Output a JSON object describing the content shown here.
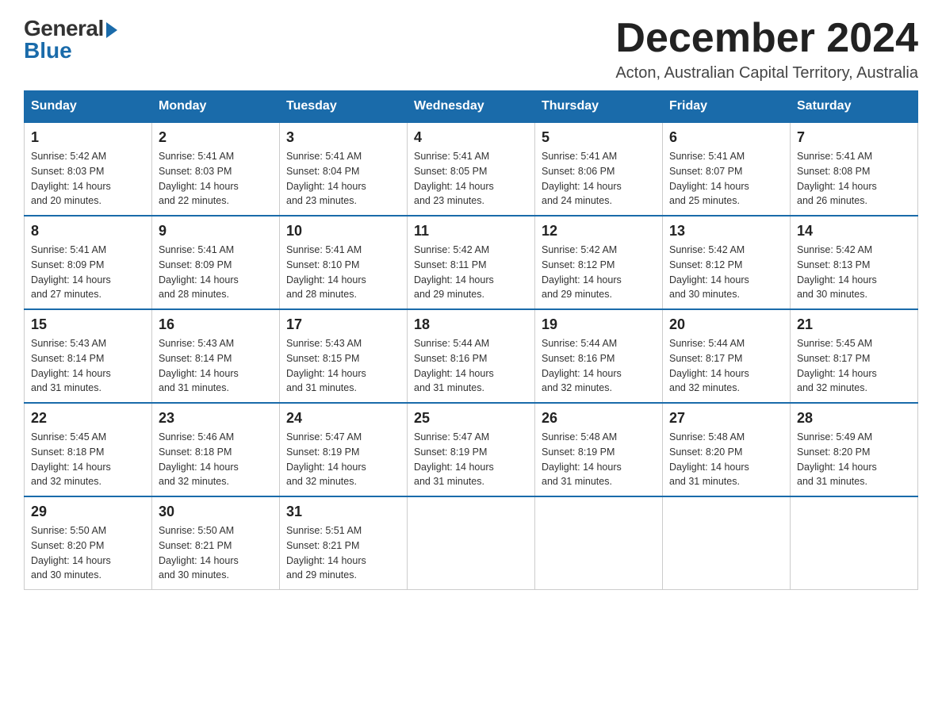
{
  "logo": {
    "general": "General",
    "blue": "Blue"
  },
  "title": {
    "month": "December 2024",
    "location": "Acton, Australian Capital Territory, Australia"
  },
  "weekdays": [
    "Sunday",
    "Monday",
    "Tuesday",
    "Wednesday",
    "Thursday",
    "Friday",
    "Saturday"
  ],
  "weeks": [
    [
      {
        "day": 1,
        "sunrise": "5:42 AM",
        "sunset": "8:03 PM",
        "daylight": "14 hours and 20 minutes."
      },
      {
        "day": 2,
        "sunrise": "5:41 AM",
        "sunset": "8:03 PM",
        "daylight": "14 hours and 22 minutes."
      },
      {
        "day": 3,
        "sunrise": "5:41 AM",
        "sunset": "8:04 PM",
        "daylight": "14 hours and 23 minutes."
      },
      {
        "day": 4,
        "sunrise": "5:41 AM",
        "sunset": "8:05 PM",
        "daylight": "14 hours and 23 minutes."
      },
      {
        "day": 5,
        "sunrise": "5:41 AM",
        "sunset": "8:06 PM",
        "daylight": "14 hours and 24 minutes."
      },
      {
        "day": 6,
        "sunrise": "5:41 AM",
        "sunset": "8:07 PM",
        "daylight": "14 hours and 25 minutes."
      },
      {
        "day": 7,
        "sunrise": "5:41 AM",
        "sunset": "8:08 PM",
        "daylight": "14 hours and 26 minutes."
      }
    ],
    [
      {
        "day": 8,
        "sunrise": "5:41 AM",
        "sunset": "8:09 PM",
        "daylight": "14 hours and 27 minutes."
      },
      {
        "day": 9,
        "sunrise": "5:41 AM",
        "sunset": "8:09 PM",
        "daylight": "14 hours and 28 minutes."
      },
      {
        "day": 10,
        "sunrise": "5:41 AM",
        "sunset": "8:10 PM",
        "daylight": "14 hours and 28 minutes."
      },
      {
        "day": 11,
        "sunrise": "5:42 AM",
        "sunset": "8:11 PM",
        "daylight": "14 hours and 29 minutes."
      },
      {
        "day": 12,
        "sunrise": "5:42 AM",
        "sunset": "8:12 PM",
        "daylight": "14 hours and 29 minutes."
      },
      {
        "day": 13,
        "sunrise": "5:42 AM",
        "sunset": "8:12 PM",
        "daylight": "14 hours and 30 minutes."
      },
      {
        "day": 14,
        "sunrise": "5:42 AM",
        "sunset": "8:13 PM",
        "daylight": "14 hours and 30 minutes."
      }
    ],
    [
      {
        "day": 15,
        "sunrise": "5:43 AM",
        "sunset": "8:14 PM",
        "daylight": "14 hours and 31 minutes."
      },
      {
        "day": 16,
        "sunrise": "5:43 AM",
        "sunset": "8:14 PM",
        "daylight": "14 hours and 31 minutes."
      },
      {
        "day": 17,
        "sunrise": "5:43 AM",
        "sunset": "8:15 PM",
        "daylight": "14 hours and 31 minutes."
      },
      {
        "day": 18,
        "sunrise": "5:44 AM",
        "sunset": "8:16 PM",
        "daylight": "14 hours and 31 minutes."
      },
      {
        "day": 19,
        "sunrise": "5:44 AM",
        "sunset": "8:16 PM",
        "daylight": "14 hours and 32 minutes."
      },
      {
        "day": 20,
        "sunrise": "5:44 AM",
        "sunset": "8:17 PM",
        "daylight": "14 hours and 32 minutes."
      },
      {
        "day": 21,
        "sunrise": "5:45 AM",
        "sunset": "8:17 PM",
        "daylight": "14 hours and 32 minutes."
      }
    ],
    [
      {
        "day": 22,
        "sunrise": "5:45 AM",
        "sunset": "8:18 PM",
        "daylight": "14 hours and 32 minutes."
      },
      {
        "day": 23,
        "sunrise": "5:46 AM",
        "sunset": "8:18 PM",
        "daylight": "14 hours and 32 minutes."
      },
      {
        "day": 24,
        "sunrise": "5:47 AM",
        "sunset": "8:19 PM",
        "daylight": "14 hours and 32 minutes."
      },
      {
        "day": 25,
        "sunrise": "5:47 AM",
        "sunset": "8:19 PM",
        "daylight": "14 hours and 31 minutes."
      },
      {
        "day": 26,
        "sunrise": "5:48 AM",
        "sunset": "8:19 PM",
        "daylight": "14 hours and 31 minutes."
      },
      {
        "day": 27,
        "sunrise": "5:48 AM",
        "sunset": "8:20 PM",
        "daylight": "14 hours and 31 minutes."
      },
      {
        "day": 28,
        "sunrise": "5:49 AM",
        "sunset": "8:20 PM",
        "daylight": "14 hours and 31 minutes."
      }
    ],
    [
      {
        "day": 29,
        "sunrise": "5:50 AM",
        "sunset": "8:20 PM",
        "daylight": "14 hours and 30 minutes."
      },
      {
        "day": 30,
        "sunrise": "5:50 AM",
        "sunset": "8:21 PM",
        "daylight": "14 hours and 30 minutes."
      },
      {
        "day": 31,
        "sunrise": "5:51 AM",
        "sunset": "8:21 PM",
        "daylight": "14 hours and 29 minutes."
      },
      null,
      null,
      null,
      null
    ]
  ],
  "labels": {
    "sunrise": "Sunrise:",
    "sunset": "Sunset:",
    "daylight": "Daylight:"
  }
}
